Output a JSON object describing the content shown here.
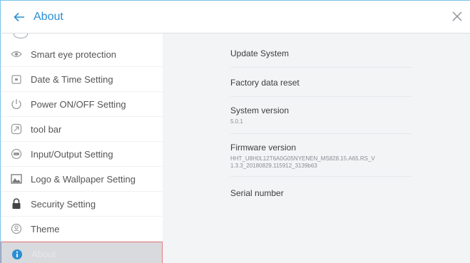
{
  "header": {
    "title": "About"
  },
  "sidebar": {
    "items": [
      {
        "label": "Smart eye protection",
        "icon": "eye-icon"
      },
      {
        "label": "Date & Time Setting",
        "icon": "calendar-icon"
      },
      {
        "label": "Power ON/OFF Setting",
        "icon": "power-icon"
      },
      {
        "label": "tool bar",
        "icon": "toolbar-icon"
      },
      {
        "label": "Input/Output Setting",
        "icon": "input-output-icon"
      },
      {
        "label": "Logo & Wallpaper Setting",
        "icon": "wallpaper-icon"
      },
      {
        "label": "Security Setting",
        "icon": "lock-icon"
      },
      {
        "label": "Theme",
        "icon": "theme-icon"
      },
      {
        "label": "About",
        "icon": "info-icon",
        "active": true
      }
    ]
  },
  "main": {
    "update_system": "Update System",
    "factory_reset": "Factory data reset",
    "system_version_label": "System version",
    "system_version_value": "5.0.1",
    "firmware_version_label": "Firmware version",
    "firmware_version_value": "HHT_U8H0L12T6A0G05NYENEN_MS828.15.A65.RS_V 1.3.3_20180829.115912_3139b63",
    "serial_number_label": "Serial number"
  },
  "colors": {
    "accent": "#2a8fd4",
    "active_border": "#e87a7a"
  }
}
